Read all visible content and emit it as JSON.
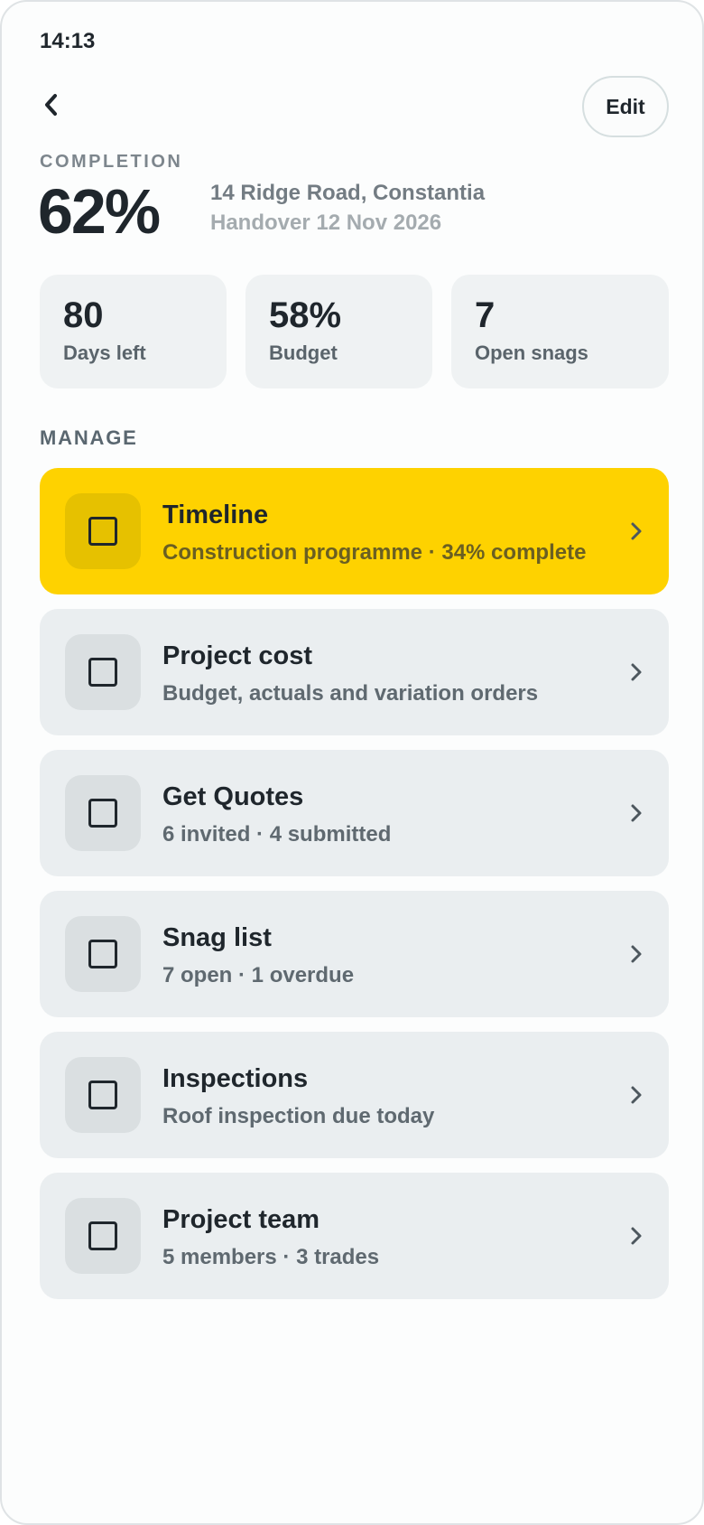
{
  "status_bar": {
    "time": "14:13"
  },
  "header": {
    "back_icon": "chevron-left-icon",
    "edit_label": "Edit"
  },
  "summary": {
    "completion_label": "COMPLETION",
    "completion_value": "62%",
    "address": "14 Ridge Road, Constantia",
    "handover": "Handover 12 Nov 2026"
  },
  "stats": [
    {
      "value": "80",
      "label": "Days left"
    },
    {
      "value": "58%",
      "label": "Budget"
    },
    {
      "value": "7",
      "label": "Open snags"
    }
  ],
  "manage": {
    "title": "MANAGE",
    "items": [
      {
        "title": "Timeline",
        "subtitle": "Construction programme · 34% complete",
        "icon": "square-icon",
        "active": true
      },
      {
        "title": "Project cost",
        "subtitle": "Budget, actuals and variation orders",
        "icon": "square-icon",
        "active": false
      },
      {
        "title": "Get Quotes",
        "subtitle": "6 invited · 4 submitted",
        "icon": "square-icon",
        "active": false
      },
      {
        "title": "Snag list",
        "subtitle": "7 open · 1 overdue",
        "icon": "square-icon",
        "active": false
      },
      {
        "title": "Inspections",
        "subtitle": "Roof inspection due today",
        "icon": "square-icon",
        "active": false
      },
      {
        "title": "Project team",
        "subtitle": "5 members · 3 trades",
        "icon": "square-icon",
        "active": false
      }
    ]
  },
  "colors": {
    "accent": "#FED200",
    "card": "#EAEEF0",
    "text": "#1F262C"
  }
}
